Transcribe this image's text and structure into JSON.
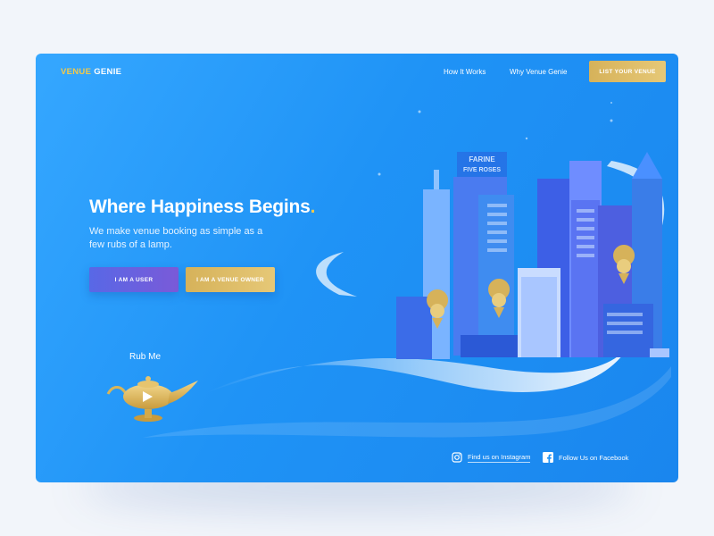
{
  "brand": {
    "part1": "VENUE",
    "part2": "GENIE",
    "accent_color": "#f2c94c"
  },
  "nav": {
    "items": [
      "How It Works",
      "Why Venue Genie"
    ],
    "cta": "LIST YOUR VENUE"
  },
  "hero": {
    "title": "Where Happiness Begins",
    "title_dot": ".",
    "subtitle": "We make venue booking as simple as a few rubs of a lamp.",
    "buttons": {
      "user": "I AM A USER",
      "owner": "I AM A VENUE OWNER"
    }
  },
  "lamp": {
    "label": "Rub Me",
    "icon": "magic-lamp-play-icon"
  },
  "illustration": {
    "sign_line1": "FARINE",
    "sign_line2": "FIVE ROSES"
  },
  "social": {
    "instagram": "Find us on Instagram",
    "facebook": "Follow Us on Facebook"
  },
  "colors": {
    "background": "#1f93f6",
    "gold": "#d6b25a",
    "purple": "#6a5ee0"
  }
}
